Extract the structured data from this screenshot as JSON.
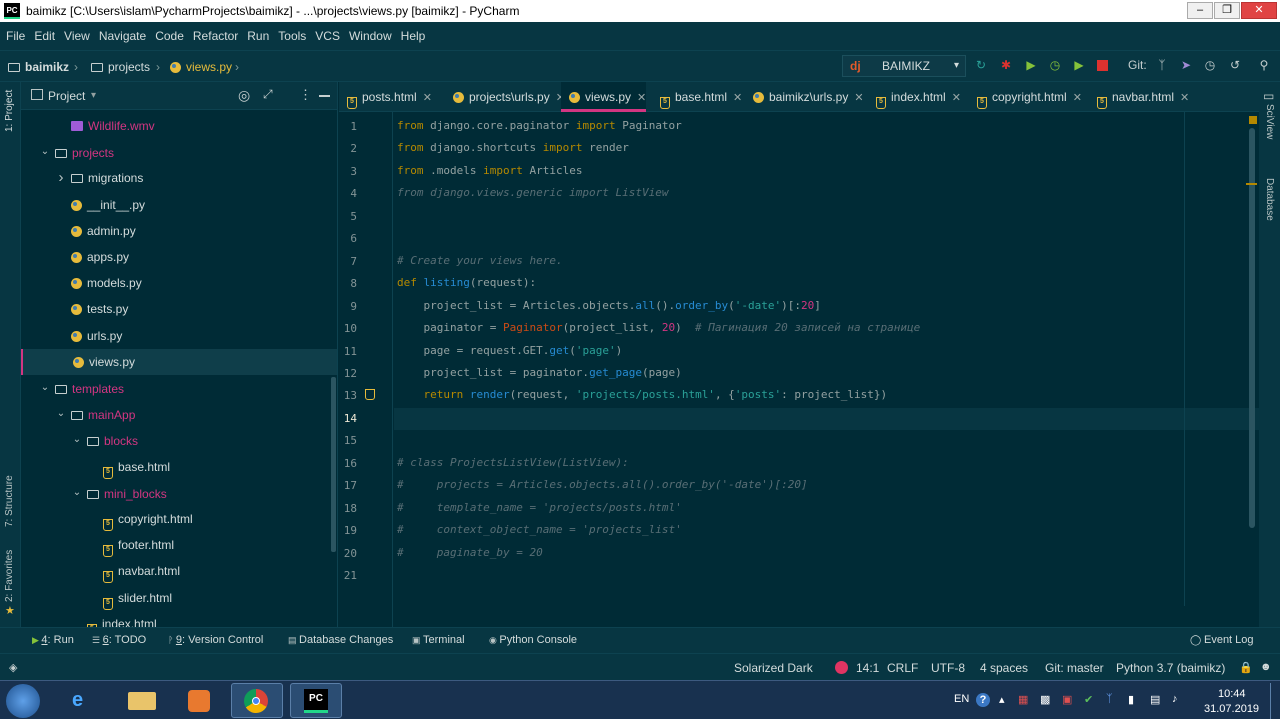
{
  "window": {
    "title": "baimikz [C:\\Users\\islam\\PycharmProjects\\baimikz] - ...\\projects\\views.py [baimikz] - PyCharm"
  },
  "menu": [
    "File",
    "Edit",
    "View",
    "Navigate",
    "Code",
    "Refactor",
    "Run",
    "Tools",
    "VCS",
    "Window",
    "Help"
  ],
  "breadcrumb": {
    "root": "baimikz",
    "folder": "projects",
    "file": "views.py"
  },
  "toolbar": {
    "run_config": "BAIMIKZ",
    "git_label": "Git:"
  },
  "side_left": {
    "project": "1: Project",
    "structure": "7: Structure",
    "favorites": "2: Favorites"
  },
  "side_right": {
    "sciview": "SciView",
    "database": "Database"
  },
  "project_panel": {
    "title": "Project"
  },
  "tree": [
    {
      "label": "Wildlife.wmv",
      "indent": 2,
      "icon": "video",
      "color": "pink",
      "arrow": ""
    },
    {
      "label": "projects",
      "indent": 1,
      "icon": "folder",
      "color": "pink",
      "arrow": "down"
    },
    {
      "label": "migrations",
      "indent": 2,
      "icon": "folder",
      "color": "",
      "arrow": "right"
    },
    {
      "label": "__init__.py",
      "indent": 2,
      "icon": "py",
      "color": "",
      "arrow": ""
    },
    {
      "label": "admin.py",
      "indent": 2,
      "icon": "py",
      "color": "",
      "arrow": ""
    },
    {
      "label": "apps.py",
      "indent": 2,
      "icon": "py",
      "color": "",
      "arrow": ""
    },
    {
      "label": "models.py",
      "indent": 2,
      "icon": "py",
      "color": "",
      "arrow": ""
    },
    {
      "label": "tests.py",
      "indent": 2,
      "icon": "py",
      "color": "",
      "arrow": ""
    },
    {
      "label": "urls.py",
      "indent": 2,
      "icon": "py",
      "color": "",
      "arrow": ""
    },
    {
      "label": "views.py",
      "indent": 2,
      "icon": "py",
      "color": "",
      "arrow": "",
      "selected": true
    },
    {
      "label": "templates",
      "indent": 1,
      "icon": "folder",
      "color": "pink",
      "arrow": "down"
    },
    {
      "label": "mainApp",
      "indent": 2,
      "icon": "folder",
      "color": "pink",
      "arrow": "down"
    },
    {
      "label": "blocks",
      "indent": 3,
      "icon": "folder",
      "color": "pink",
      "arrow": "down"
    },
    {
      "label": "base.html",
      "indent": 4,
      "icon": "html",
      "color": "",
      "arrow": ""
    },
    {
      "label": "mini_blocks",
      "indent": 3,
      "icon": "folder",
      "color": "pink",
      "arrow": "down"
    },
    {
      "label": "copyright.html",
      "indent": 4,
      "icon": "html",
      "color": "",
      "arrow": ""
    },
    {
      "label": "footer.html",
      "indent": 4,
      "icon": "html",
      "color": "",
      "arrow": ""
    },
    {
      "label": "navbar.html",
      "indent": 4,
      "icon": "html",
      "color": "",
      "arrow": ""
    },
    {
      "label": "slider.html",
      "indent": 4,
      "icon": "html",
      "color": "",
      "arrow": ""
    },
    {
      "label": "index.html",
      "indent": 3,
      "icon": "html",
      "color": "",
      "arrow": ""
    }
  ],
  "tabs": [
    {
      "label": "posts.html",
      "icon": "html"
    },
    {
      "label": "projects\\urls.py",
      "icon": "py"
    },
    {
      "label": "views.py",
      "icon": "py",
      "active": true
    },
    {
      "label": "base.html",
      "icon": "html"
    },
    {
      "label": "baimikz\\urls.py",
      "icon": "py"
    },
    {
      "label": "index.html",
      "icon": "html"
    },
    {
      "label": "copyright.html",
      "icon": "html"
    },
    {
      "label": "navbar.html",
      "icon": "html"
    }
  ],
  "code": [
    "from django.core.paginator import Paginator",
    "from django.shortcuts import render",
    "from .models import Articles",
    "from django.views.generic import ListView",
    "",
    "",
    "# Create your views here.",
    "def listing(request):",
    "    project_list = Articles.objects.all().order_by('-date')[:20]",
    "    paginator = Paginator(project_list, 20)  # Пагинация 20 записей на странице",
    "    page = request.GET.get('page')",
    "    project_list = paginator.get_page(page)",
    "    return render(request, 'projects/posts.html', {'posts': project_list})",
    "",
    "",
    "# class ProjectsListView(ListView):",
    "#     projects = Articles.objects.all().order_by('-date')[:20]",
    "#     template_name = 'projects/posts.html'",
    "#     context_object_name = 'projects_list'",
    "#     paginate_by = 20",
    ""
  ],
  "current_line": 14,
  "bottom_tools": [
    {
      "num": "4",
      "label": ": Run"
    },
    {
      "num": "6",
      "label": ": TODO"
    },
    {
      "num": "9",
      "label": ": Version Control"
    },
    {
      "num": "",
      "label": "Database Changes"
    },
    {
      "num": "",
      "label": "Terminal"
    },
    {
      "num": "",
      "label": "Python Console"
    }
  ],
  "event_log": "Event Log",
  "status": {
    "theme": "Solarized Dark",
    "position": "14:1",
    "line_sep": "CRLF",
    "encoding": "UTF-8",
    "indent": "4 spaces",
    "git": "Git: master",
    "interpreter": "Python 3.7 (baimikz)"
  },
  "taskbar": {
    "lang": "EN",
    "time": "10:44",
    "date": "31.07.2019"
  },
  "colors": {
    "accent": "#d33682",
    "bg": "#002b36",
    "panel": "#073642",
    "keyword": "#b58900",
    "string": "#2aa198"
  }
}
